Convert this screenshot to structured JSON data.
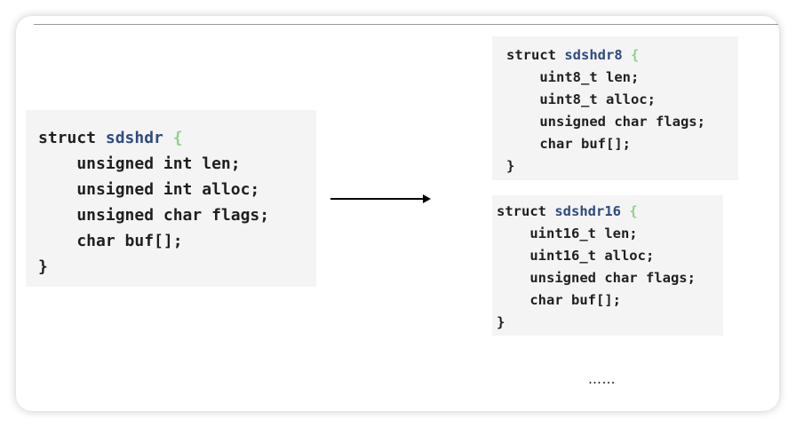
{
  "left_struct": {
    "keyword": "struct",
    "name": "sdshdr",
    "open_brace": "{",
    "fields": [
      "    unsigned int len;",
      "    unsigned int alloc;",
      "    unsigned char flags;",
      "    char buf[];"
    ],
    "close_brace": "}"
  },
  "right_struct_8": {
    "keyword": "struct",
    "name": "sdshdr8",
    "open_brace": "{",
    "fields": [
      "    uint8_t len;",
      "    uint8_t alloc;",
      "    unsigned char flags;",
      "    char buf[];"
    ],
    "close_brace": "}"
  },
  "right_struct_16": {
    "keyword": "struct",
    "name": "sdshdr16",
    "open_brace": "{",
    "fields": [
      "    uint16_t len;",
      "    uint16_t alloc;",
      "    unsigned char flags;",
      "    char buf[];"
    ],
    "close_brace": "}"
  },
  "ellipsis": "……",
  "colors": {
    "code_background": "#f4f4f4",
    "struct_name": "#2f4a7f",
    "brace": "#8fcf8f"
  }
}
